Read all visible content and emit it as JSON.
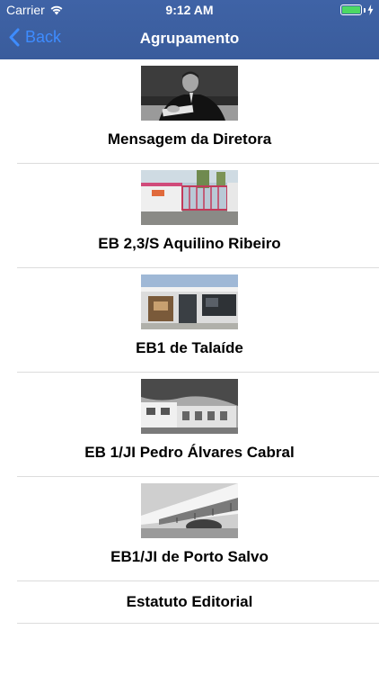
{
  "status_bar": {
    "carrier": "Carrier",
    "time": "9:12 AM",
    "icons": [
      "wifi-icon",
      "battery-icon",
      "charging-bolt-icon"
    ],
    "battery_color": "#4cd964"
  },
  "nav": {
    "back_label": "Back",
    "title": "Agrupamento",
    "bar_color": "#3d5fa1",
    "tint_color": "#3e8cff"
  },
  "items": [
    {
      "label": "Mensagem da Diretora",
      "image": "director-portrait-photo"
    },
    {
      "label": "EB 2,3/S Aquilino Ribeiro",
      "image": "school-gate-photo"
    },
    {
      "label": "EB1 de Talaíde",
      "image": "school-building-photo"
    },
    {
      "label": "EB 1/JI Pedro Álvares Cabral",
      "image": "school-bw-photo"
    },
    {
      "label": "EB1/JI de Porto Salvo",
      "image": "school-street-photo"
    },
    {
      "label": "Estatuto Editorial"
    }
  ]
}
